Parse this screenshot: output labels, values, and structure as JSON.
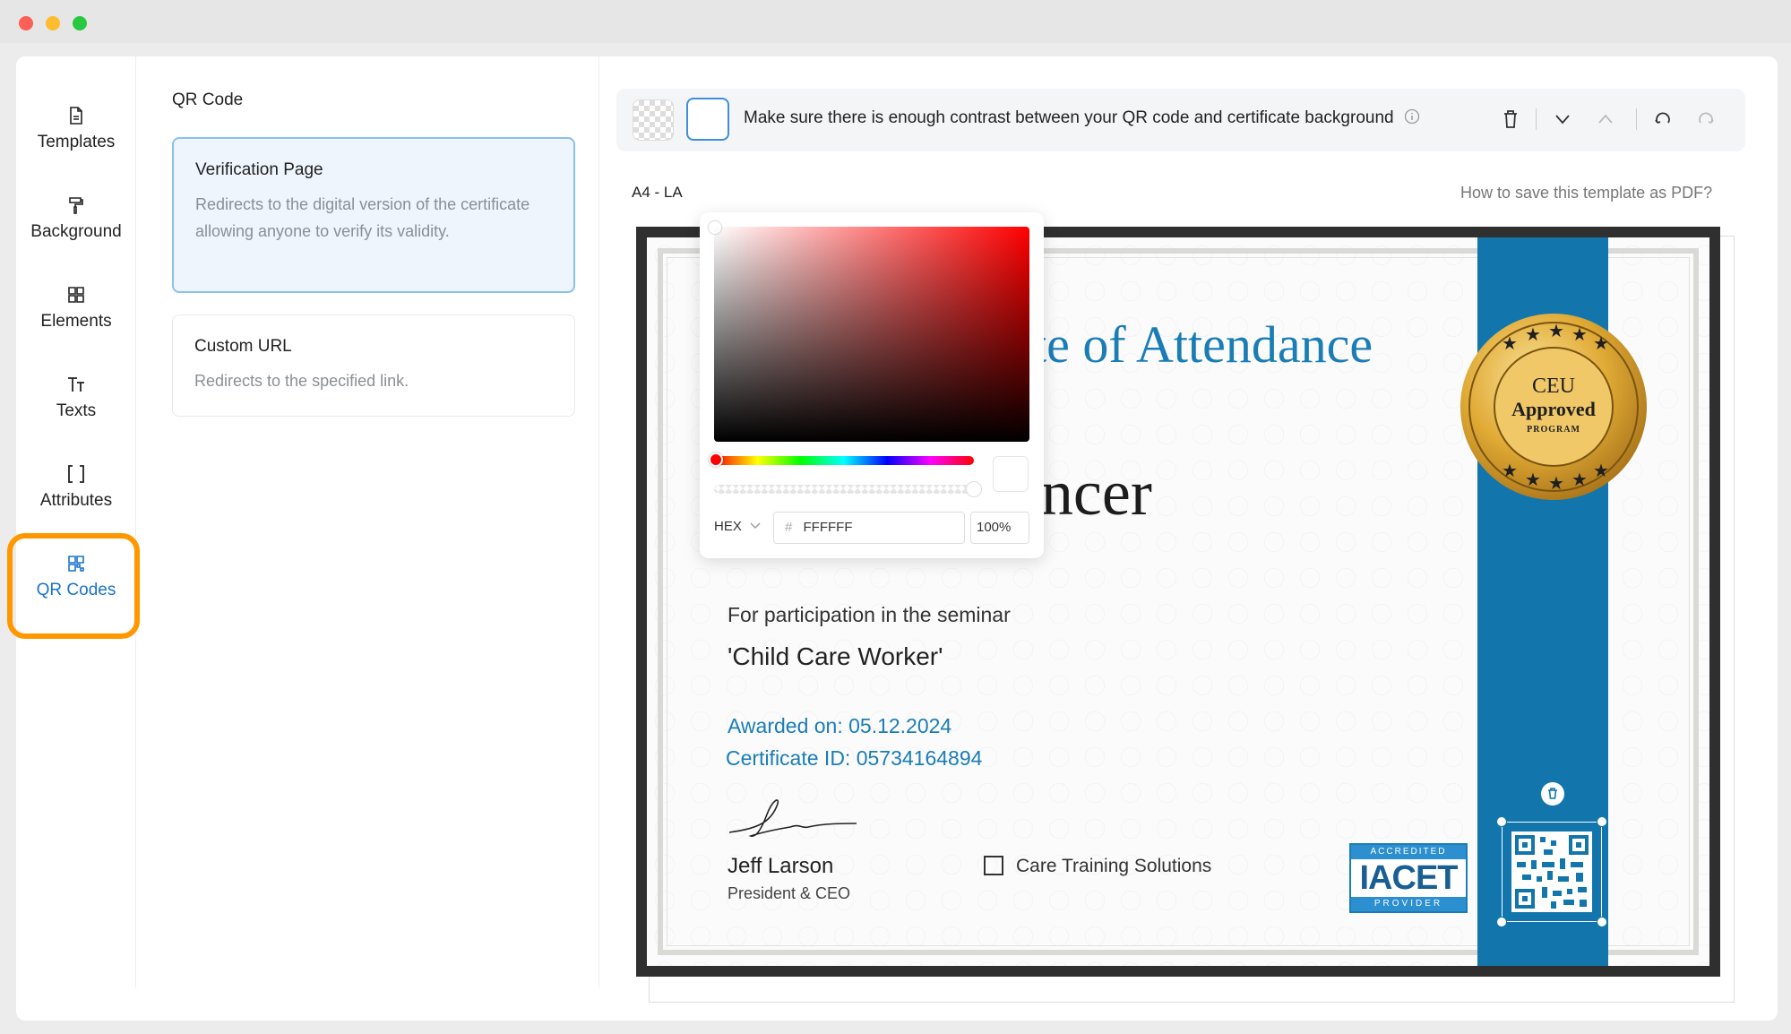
{
  "sidebar": {
    "items": [
      {
        "label": "Templates",
        "icon": "document-icon"
      },
      {
        "label": "Background",
        "icon": "paint-roller-icon"
      },
      {
        "label": "Elements",
        "icon": "grid-icon"
      },
      {
        "label": "Texts",
        "icon": "text-icon"
      },
      {
        "label": "Attributes",
        "icon": "brackets-icon"
      },
      {
        "label": "QR Codes",
        "icon": "qr-code-icon",
        "active": true
      }
    ]
  },
  "panel": {
    "title": "QR Code",
    "options": [
      {
        "title": "Verification Page",
        "description": "Redirects to the digital version of the certificate allowing anyone to verify its validity.",
        "selected": true
      },
      {
        "title": "Custom URL",
        "description": "Redirects to the specified link.",
        "selected": false
      }
    ]
  },
  "toolbar": {
    "message": "Make sure there is enough contrast between your QR code and certificate background"
  },
  "canvas": {
    "paper_label": "A4 - LA",
    "help_link": "How to save this template as PDF?"
  },
  "color_picker": {
    "format": "HEX",
    "hex_value": "FFFFFF",
    "hash": "#",
    "alpha": "100%"
  },
  "certificate": {
    "title_visible": "te of Attendance",
    "recipient": "Hannah Spencer",
    "participation_text": "For participation in the seminar",
    "course": "'Child Care Worker'",
    "awarded": "Awarded on: 05.12.2024",
    "certificate_id": "Certificate ID: 05734164894",
    "signer_name": "Jeff Larson",
    "signer_role": "President & CEO",
    "company": "Care Training Solutions",
    "seal_line1": "CEU",
    "seal_line2": "Approved",
    "seal_line3": "PROGRAM",
    "badge_top": "ACCREDITED",
    "badge_mid": "IACET",
    "badge_bottom": "PROVIDER"
  },
  "colors": {
    "accent": "#1a73c9",
    "highlight": "#ff9800",
    "ribbon": "#1276ac",
    "gold": "#d4a02a"
  }
}
